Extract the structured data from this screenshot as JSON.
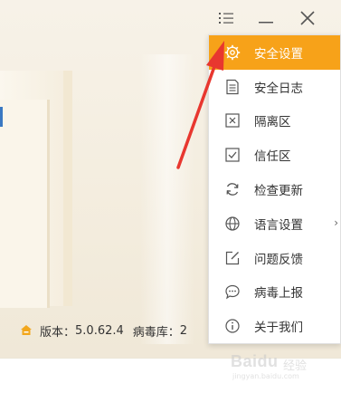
{
  "window": {
    "menu_icon": "hamburger-list-icon",
    "minimize_icon": "minimize-icon",
    "close_icon": "close-icon"
  },
  "status": {
    "version_label": "版本：",
    "version_value": "5.0.62.4",
    "virus_db_label": "病毒库：",
    "virus_db_value": "2"
  },
  "menu": {
    "items": [
      {
        "label": "安全设置",
        "icon": "gear-icon",
        "active": true
      },
      {
        "label": "安全日志",
        "icon": "document-icon"
      },
      {
        "label": "隔离区",
        "icon": "quarantine-box-icon"
      },
      {
        "label": "信任区",
        "icon": "checkbox-icon"
      },
      {
        "label": "检查更新",
        "icon": "refresh-icon"
      },
      {
        "label": "语言设置",
        "icon": "globe-icon",
        "has_submenu": true
      },
      {
        "label": "问题反馈",
        "icon": "edit-icon"
      },
      {
        "label": "病毒上报",
        "icon": "chat-bubble-icon"
      },
      {
        "label": "关于我们",
        "icon": "info-icon"
      }
    ]
  },
  "watermark": {
    "brand": "Baidu",
    "suffix": "经验",
    "url": "jingyan.baidu.com"
  },
  "colors": {
    "accent": "#f7a219",
    "arrow": "#e8372f"
  }
}
